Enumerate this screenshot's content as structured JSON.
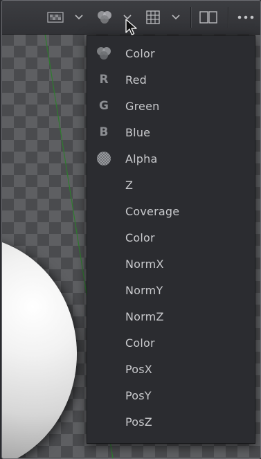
{
  "toolbar": {
    "icons": [
      "monitor-lut-icon",
      "chevron-down-icon",
      "channels-icon",
      "chevron-down-icon",
      "grid-icon",
      "chevron-down-icon",
      "split-view-icon",
      "more-options-icon"
    ]
  },
  "channel_menu": {
    "items": [
      {
        "label": "Color",
        "icon": "rgb-circles-icon"
      },
      {
        "label": "Red",
        "icon_text": "R"
      },
      {
        "label": "Green",
        "icon_text": "G"
      },
      {
        "label": "Blue",
        "icon_text": "B"
      },
      {
        "label": "Alpha",
        "icon": "alpha-checker-icon"
      },
      {
        "label": "Z"
      },
      {
        "label": "Coverage"
      },
      {
        "label": "Color"
      },
      {
        "label": "NormX"
      },
      {
        "label": "NormY"
      },
      {
        "label": "NormZ"
      },
      {
        "label": "Color"
      },
      {
        "label": "PosX"
      },
      {
        "label": "PosY"
      },
      {
        "label": "PosZ"
      }
    ]
  }
}
